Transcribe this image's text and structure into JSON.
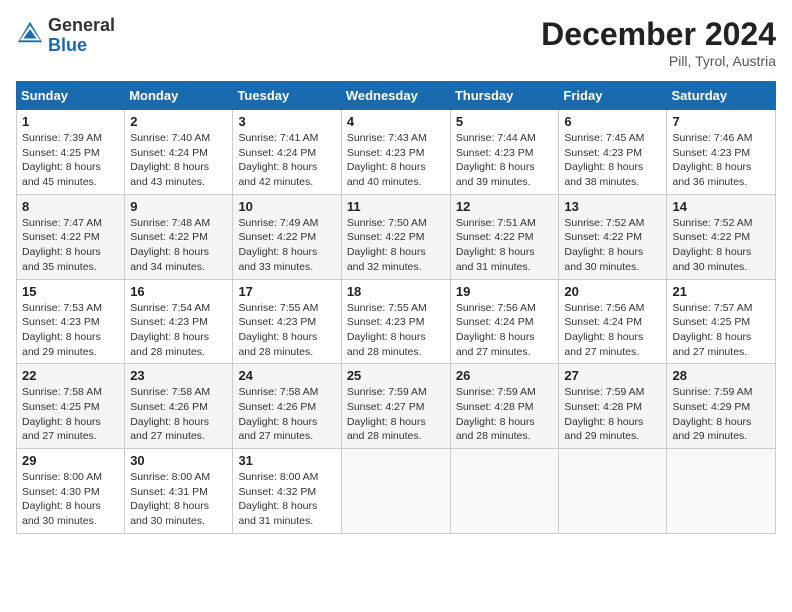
{
  "header": {
    "logo": {
      "general": "General",
      "blue": "Blue"
    },
    "title": "December 2024",
    "location": "Pill, Tyrol, Austria"
  },
  "calendar": {
    "days_of_week": [
      "Sunday",
      "Monday",
      "Tuesday",
      "Wednesday",
      "Thursday",
      "Friday",
      "Saturday"
    ],
    "weeks": [
      [
        {
          "day": "1",
          "sunrise": "7:39 AM",
          "sunset": "4:25 PM",
          "daylight": "8 hours and 45 minutes."
        },
        {
          "day": "2",
          "sunrise": "7:40 AM",
          "sunset": "4:24 PM",
          "daylight": "8 hours and 43 minutes."
        },
        {
          "day": "3",
          "sunrise": "7:41 AM",
          "sunset": "4:24 PM",
          "daylight": "8 hours and 42 minutes."
        },
        {
          "day": "4",
          "sunrise": "7:43 AM",
          "sunset": "4:23 PM",
          "daylight": "8 hours and 40 minutes."
        },
        {
          "day": "5",
          "sunrise": "7:44 AM",
          "sunset": "4:23 PM",
          "daylight": "8 hours and 39 minutes."
        },
        {
          "day": "6",
          "sunrise": "7:45 AM",
          "sunset": "4:23 PM",
          "daylight": "8 hours and 38 minutes."
        },
        {
          "day": "7",
          "sunrise": "7:46 AM",
          "sunset": "4:23 PM",
          "daylight": "8 hours and 36 minutes."
        }
      ],
      [
        {
          "day": "8",
          "sunrise": "7:47 AM",
          "sunset": "4:22 PM",
          "daylight": "8 hours and 35 minutes."
        },
        {
          "day": "9",
          "sunrise": "7:48 AM",
          "sunset": "4:22 PM",
          "daylight": "8 hours and 34 minutes."
        },
        {
          "day": "10",
          "sunrise": "7:49 AM",
          "sunset": "4:22 PM",
          "daylight": "8 hours and 33 minutes."
        },
        {
          "day": "11",
          "sunrise": "7:50 AM",
          "sunset": "4:22 PM",
          "daylight": "8 hours and 32 minutes."
        },
        {
          "day": "12",
          "sunrise": "7:51 AM",
          "sunset": "4:22 PM",
          "daylight": "8 hours and 31 minutes."
        },
        {
          "day": "13",
          "sunrise": "7:52 AM",
          "sunset": "4:22 PM",
          "daylight": "8 hours and 30 minutes."
        },
        {
          "day": "14",
          "sunrise": "7:52 AM",
          "sunset": "4:22 PM",
          "daylight": "8 hours and 30 minutes."
        }
      ],
      [
        {
          "day": "15",
          "sunrise": "7:53 AM",
          "sunset": "4:23 PM",
          "daylight": "8 hours and 29 minutes."
        },
        {
          "day": "16",
          "sunrise": "7:54 AM",
          "sunset": "4:23 PM",
          "daylight": "8 hours and 28 minutes."
        },
        {
          "day": "17",
          "sunrise": "7:55 AM",
          "sunset": "4:23 PM",
          "daylight": "8 hours and 28 minutes."
        },
        {
          "day": "18",
          "sunrise": "7:55 AM",
          "sunset": "4:23 PM",
          "daylight": "8 hours and 28 minutes."
        },
        {
          "day": "19",
          "sunrise": "7:56 AM",
          "sunset": "4:24 PM",
          "daylight": "8 hours and 27 minutes."
        },
        {
          "day": "20",
          "sunrise": "7:56 AM",
          "sunset": "4:24 PM",
          "daylight": "8 hours and 27 minutes."
        },
        {
          "day": "21",
          "sunrise": "7:57 AM",
          "sunset": "4:25 PM",
          "daylight": "8 hours and 27 minutes."
        }
      ],
      [
        {
          "day": "22",
          "sunrise": "7:58 AM",
          "sunset": "4:25 PM",
          "daylight": "8 hours and 27 minutes."
        },
        {
          "day": "23",
          "sunrise": "7:58 AM",
          "sunset": "4:26 PM",
          "daylight": "8 hours and 27 minutes."
        },
        {
          "day": "24",
          "sunrise": "7:58 AM",
          "sunset": "4:26 PM",
          "daylight": "8 hours and 27 minutes."
        },
        {
          "day": "25",
          "sunrise": "7:59 AM",
          "sunset": "4:27 PM",
          "daylight": "8 hours and 28 minutes."
        },
        {
          "day": "26",
          "sunrise": "7:59 AM",
          "sunset": "4:28 PM",
          "daylight": "8 hours and 28 minutes."
        },
        {
          "day": "27",
          "sunrise": "7:59 AM",
          "sunset": "4:28 PM",
          "daylight": "8 hours and 29 minutes."
        },
        {
          "day": "28",
          "sunrise": "7:59 AM",
          "sunset": "4:29 PM",
          "daylight": "8 hours and 29 minutes."
        }
      ],
      [
        {
          "day": "29",
          "sunrise": "8:00 AM",
          "sunset": "4:30 PM",
          "daylight": "8 hours and 30 minutes."
        },
        {
          "day": "30",
          "sunrise": "8:00 AM",
          "sunset": "4:31 PM",
          "daylight": "8 hours and 30 minutes."
        },
        {
          "day": "31",
          "sunrise": "8:00 AM",
          "sunset": "4:32 PM",
          "daylight": "8 hours and 31 minutes."
        },
        null,
        null,
        null,
        null
      ]
    ],
    "labels": {
      "sunrise": "Sunrise:",
      "sunset": "Sunset:",
      "daylight": "Daylight:"
    }
  }
}
